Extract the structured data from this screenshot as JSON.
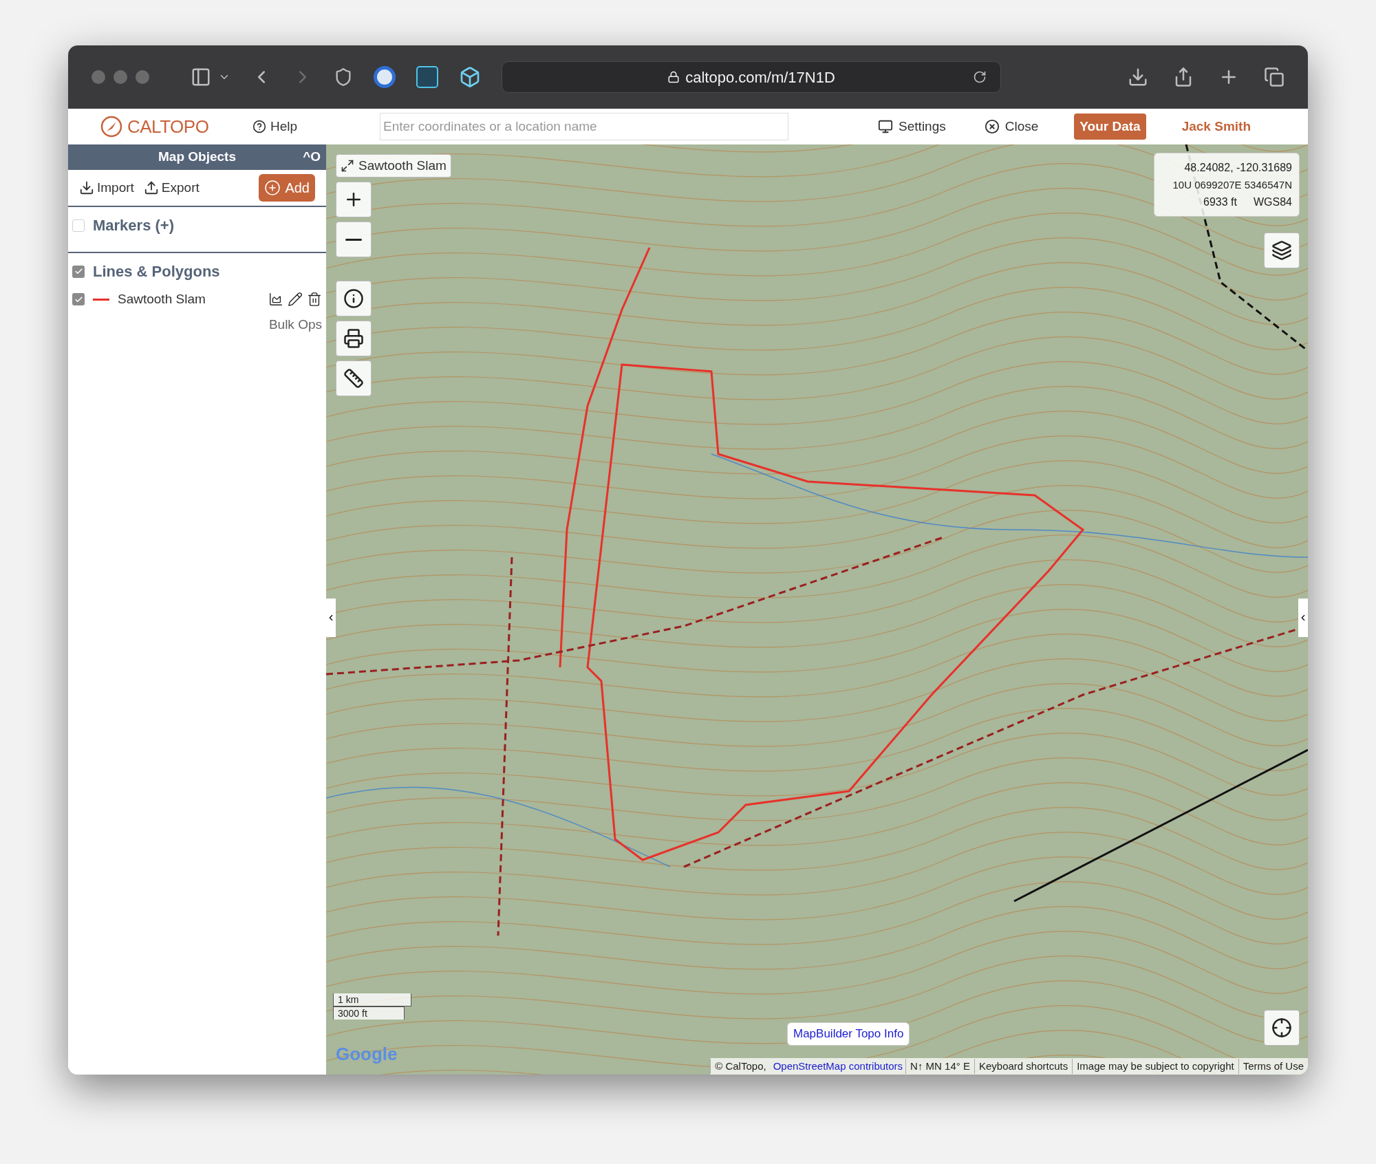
{
  "browser": {
    "url": "caltopo.com/m/17N1D"
  },
  "header": {
    "logo": "CALTOPO",
    "help": "Help",
    "search": {
      "placeholder": "Enter coordinates or a location name"
    },
    "settings": "Settings",
    "close": "Close",
    "your_data": "Your Data",
    "user": "Jack Smith"
  },
  "sidebar": {
    "title": "Map Objects",
    "collapse": "^O",
    "import": "Import",
    "export": "Export",
    "add": "Add",
    "sections": [
      {
        "label": "Markers (+)",
        "checked": false
      },
      {
        "label": "Lines & Polygons",
        "checked": true,
        "items": [
          {
            "name": "Sawtooth Slam",
            "checked": true,
            "color": "#e8312a"
          }
        ]
      }
    ],
    "bulk_ops": "Bulk Ops"
  },
  "map": {
    "title_button": "Sawtooth Slam",
    "coords": {
      "latlon": "48.24082, -120.31689",
      "utm": "10U 0699207E 5346547N",
      "elevation": "6933 ft",
      "datum": "WGS84"
    },
    "scale": [
      "1 km",
      "3000 ft"
    ],
    "google": "Google",
    "info_button": "MapBuilder Topo Info",
    "attribution": [
      {
        "kind": "text",
        "text": "© CalTopo,"
      },
      {
        "kind": "link",
        "text": "OpenStreetMap contributors"
      },
      {
        "kind": "text",
        "text": "N↑ MN 14° E"
      },
      {
        "kind": "text",
        "text": "Keyboard shortcuts"
      },
      {
        "kind": "text",
        "text": "Image may be subject to copyright"
      },
      {
        "kind": "text",
        "text": "Terms of Use"
      }
    ]
  }
}
